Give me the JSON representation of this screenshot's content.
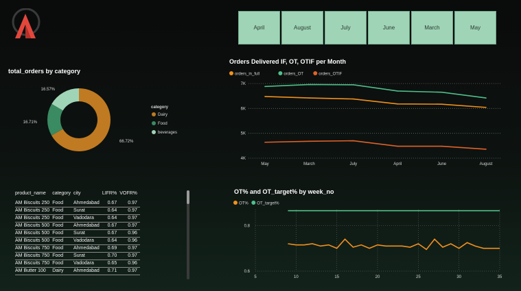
{
  "month_slicer": [
    "April",
    "August",
    "July",
    "June",
    "March",
    "May"
  ],
  "donut": {
    "title": "total_orders by category",
    "legend_title": "category",
    "slices": [
      {
        "label": "Dairy",
        "pct_label": "66.72%",
        "value": 66.72,
        "color": "#c07a22"
      },
      {
        "label": "Food",
        "pct_label": "16.71%",
        "value": 16.71,
        "color": "#3a8a62"
      },
      {
        "label": "beverages",
        "pct_label": "16.57%",
        "value": 16.57,
        "color": "#9fd4b6"
      }
    ]
  },
  "table": {
    "headers": [
      "product_name",
      "category",
      "city",
      "LIFR%",
      "VOFR%"
    ],
    "rows": [
      [
        "AM Biscuits 250",
        "Food",
        "Ahmedabad",
        "0.67",
        "0.97"
      ],
      [
        "AM Biscuits 250",
        "Food",
        "Surat",
        "0.64",
        "0.97"
      ],
      [
        "AM Biscuits 250",
        "Food",
        "Vadodara",
        "0.64",
        "0.97"
      ],
      [
        "AM Biscuits 500",
        "Food",
        "Ahmedabad",
        "0.67",
        "0.97"
      ],
      [
        "AM Biscuits 500",
        "Food",
        "Surat",
        "0.67",
        "0.96"
      ],
      [
        "AM Biscuits 500",
        "Food",
        "Vadodara",
        "0.64",
        "0.96"
      ],
      [
        "AM Biscuits 750",
        "Food",
        "Ahmedabad",
        "0.69",
        "0.97"
      ],
      [
        "AM Biscuits 750",
        "Food",
        "Surat",
        "0.70",
        "0.97"
      ],
      [
        "AM Biscuits 750",
        "Food",
        "Vadodara",
        "0.65",
        "0.96"
      ],
      [
        "AM Butter 100",
        "Dairy",
        "Ahmedabad",
        "0.71",
        "0.97"
      ]
    ]
  },
  "chart_data": [
    {
      "type": "pie",
      "title": "total_orders by category",
      "categories": [
        "Dairy",
        "Food",
        "beverages"
      ],
      "values": [
        66.72,
        16.71,
        16.57
      ]
    },
    {
      "type": "line",
      "title": "Orders Delivered IF, OT, OTIF per Month",
      "categories": [
        "May",
        "March",
        "July",
        "April",
        "June",
        "August"
      ],
      "ylim": [
        4000,
        7000
      ],
      "yticks": [
        "4K",
        "5K",
        "6K",
        "7K"
      ],
      "series": [
        {
          "name": "orders_in_full",
          "color": "#f2901c",
          "values": [
            6480,
            6420,
            6380,
            6180,
            6170,
            6040
          ]
        },
        {
          "name": "orders_OT",
          "color": "#4fbf8c",
          "values": [
            6880,
            6960,
            6950,
            6700,
            6650,
            6420
          ]
        },
        {
          "name": "orders_OTIF",
          "color": "#e0612a",
          "values": [
            4640,
            4680,
            4700,
            4480,
            4480,
            4360
          ]
        }
      ]
    },
    {
      "type": "line",
      "title": "OT% and OT_target% by week_no",
      "xlim": [
        5,
        35
      ],
      "ylim": [
        0.6,
        0.87
      ],
      "xticks": [
        "5",
        "10",
        "15",
        "20",
        "25",
        "30",
        "35"
      ],
      "yticks": [
        "0.6",
        "0.8"
      ],
      "series": [
        {
          "name": "OT%",
          "color": "#f2901c",
          "x": [
            9,
            10,
            11,
            12,
            13,
            14,
            15,
            16,
            17,
            18,
            19,
            20,
            21,
            22,
            23,
            24,
            25,
            26,
            27,
            28,
            29,
            30,
            31,
            32,
            33,
            34,
            35
          ],
          "values": [
            0.72,
            0.715,
            0.715,
            0.72,
            0.71,
            0.715,
            0.7,
            0.74,
            0.705,
            0.715,
            0.7,
            0.715,
            0.71,
            0.71,
            0.71,
            0.705,
            0.72,
            0.695,
            0.74,
            0.705,
            0.72,
            0.7,
            0.725,
            0.71,
            0.7,
            0.7,
            0.7
          ]
        },
        {
          "name": "OT_target%",
          "color": "#4fbf8c",
          "x": [
            9,
            35
          ],
          "values": [
            0.865,
            0.865
          ]
        }
      ]
    }
  ]
}
